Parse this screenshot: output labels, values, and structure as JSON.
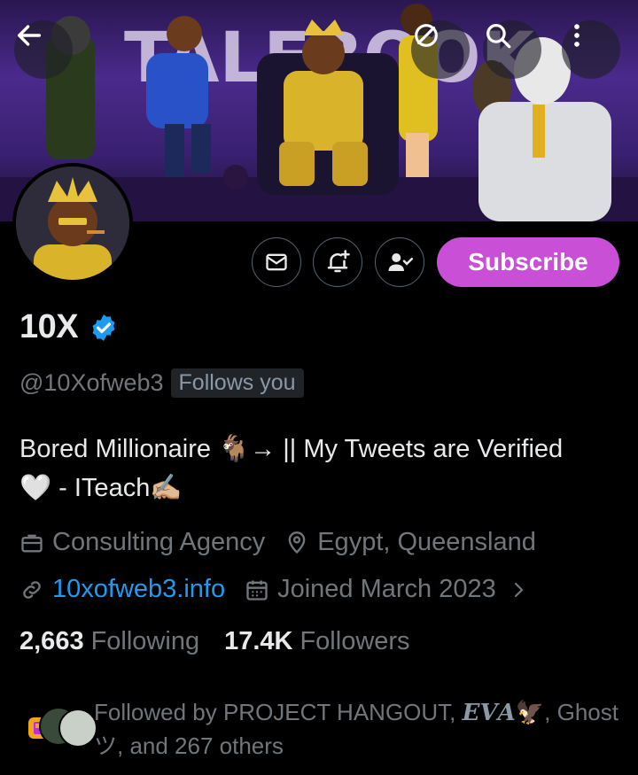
{
  "header": {
    "banner_text": "TALEBOOK",
    "back_icon": "arrow-left-icon",
    "hide_icon": "eye-slash-icon",
    "search_icon": "search-icon",
    "more_icon": "more-vertical-icon"
  },
  "actions": {
    "message_icon": "envelope-icon",
    "notify_icon": "bell-plus-icon",
    "following_icon": "user-check-icon",
    "subscribe_label": "Subscribe",
    "subscribe_color": "#c84fd6"
  },
  "profile": {
    "name": "10X",
    "verified_icon": "verified-badge-icon",
    "handle": "@10Xofweb3",
    "follows_you": "Follows you",
    "bio_line1": "Bored Millionaire 🐐→ || My Tweets are Verified",
    "bio_line2": "🤍 - ITeach✍🏼",
    "category": "Consulting Agency",
    "location": "Egypt, Queensland",
    "website": "10xofweb3.info",
    "joined": "Joined March 2023"
  },
  "stats": {
    "following_count": "2,663",
    "following_label": "Following",
    "followers_count": "17.4K",
    "followers_label": "Followers"
  },
  "followed_by": {
    "prefix": "Followed by PROJECT HANGOUT, ",
    "eva": "𝑬𝑽𝑨",
    "eva_emoji": "🦅",
    "middle": ", Ghost ツ, and 267 others"
  },
  "colors": {
    "accent_link": "#1d9bf0",
    "verified": "#1d9bf0",
    "muted": "#71767b"
  }
}
